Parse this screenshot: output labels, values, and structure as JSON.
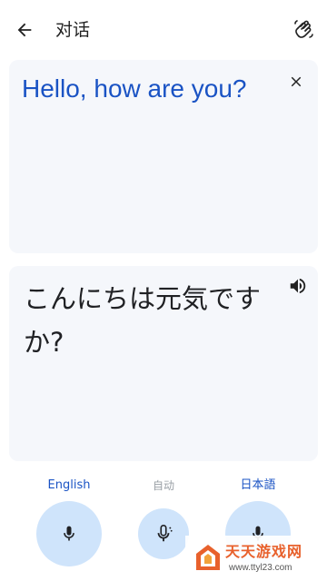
{
  "header": {
    "title": "对话",
    "back_icon": "arrow-left-icon",
    "wave_icon": "waving-hand-icon"
  },
  "source_card": {
    "text": "Hello, how are you?",
    "clear_icon": "close-icon",
    "text_color": "#1a53c4"
  },
  "target_card": {
    "text": "こんにちは元気ですか?",
    "speaker_icon": "speaker-icon"
  },
  "bottom_bar": {
    "lang_left": "English",
    "lang_auto": "自动",
    "lang_right": "日本語",
    "mic_icon": "microphone-icon",
    "accent": "#1a53c4",
    "mic_bg": "#cfe4fb"
  },
  "watermark": {
    "title": "天天游戏网",
    "url": "www.ttyl23.com"
  }
}
